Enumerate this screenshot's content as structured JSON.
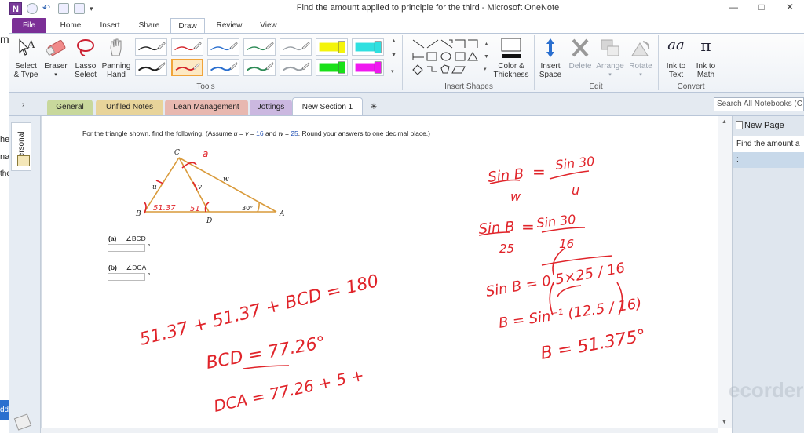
{
  "window": {
    "title": "Find the amount applied to principle for the third - Microsoft OneNote",
    "app_logo": "N",
    "controls": [
      "—",
      "□",
      "✕"
    ]
  },
  "ribbon_tabs": [
    "File",
    "Home",
    "Insert",
    "Share",
    "Draw",
    "Review",
    "View"
  ],
  "ribbon": {
    "tools_buttons": [
      {
        "label1": "Select",
        "label2": "& Type",
        "icon": "select-type-icon"
      },
      {
        "label1": "Eraser",
        "label2": "▾",
        "icon": "eraser-icon"
      },
      {
        "label1": "Lasso",
        "label2": "Select",
        "icon": "lasso-icon"
      },
      {
        "label1": "Panning",
        "label2": "Hand",
        "icon": "hand-icon"
      }
    ],
    "pen_colors": [
      "#222222",
      "#d4242a",
      "#2a6fcf",
      "#2e8b57",
      "#9aa0a6",
      "#f4f40a",
      "#2fe0e0",
      "#222222",
      "#d4242a",
      "#2a6fcf",
      "#2e8b57",
      "#9aa0a6",
      "#18e018",
      "#f018f0"
    ],
    "color_thickness": {
      "label1": "Color &",
      "label2": "Thickness"
    },
    "edit_buttons": [
      {
        "label1": "Insert",
        "label2": "Space",
        "dim": false
      },
      {
        "label1": "Delete",
        "label2": "",
        "dim": true
      },
      {
        "label1": "Arrange",
        "label2": "▾",
        "dim": true
      },
      {
        "label1": "Rotate",
        "label2": "▾",
        "dim": true
      }
    ],
    "convert_buttons": [
      {
        "label1": "Ink to",
        "label2": "Text",
        "glyph": "aa"
      },
      {
        "label1": "Ink to",
        "label2": "Math",
        "glyph": "π"
      }
    ],
    "group_labels": {
      "tools": "Tools",
      "shapes": "Insert Shapes",
      "edit": "Edit",
      "convert": "Convert"
    }
  },
  "section_tabs": [
    "General",
    "Unfiled Notes",
    "Lean Management",
    "Jottings",
    "New Section 1",
    "✳"
  ],
  "section_colors": [
    "#c8d89c",
    "#e8d49a",
    "#e8b8b0",
    "#cbb8e0",
    "#ffffff",
    "#e4eaf1"
  ],
  "search_placeholder": "Search All Notebooks (C",
  "notebook_label": "Personal",
  "left_edge_text": [
    "m",
    "he",
    "nal",
    "the",
    "dd"
  ],
  "page_list": {
    "new_page": "New Page",
    "items": [
      "Find the amount a",
      ":"
    ]
  },
  "problem": {
    "prefix": "For the triangle shown, find the following. (Assume ",
    "u": "u",
    "eq1": " = ",
    "v": "v",
    "eq2": " = ",
    "uv_value": "16",
    "and": " and ",
    "w": "w",
    "eq3": " = ",
    "w_value": "25",
    "suffix": ". Round your answers to one decimal place.)"
  },
  "triangle_labels": {
    "C": "C",
    "B": "B",
    "D": "D",
    "A": "A",
    "u": "u",
    "v": "v",
    "w": "w",
    "angle": "30°"
  },
  "parts": [
    {
      "letter": "(a)",
      "angle": "∠BCD",
      "unit": "°"
    },
    {
      "letter": "(b)",
      "angle": "∠DCA",
      "unit": "°"
    }
  ],
  "ink_notes": {
    "near_c": "a",
    "angle_b": "51.37",
    "angle_d": "51",
    "left_eq1": "51.37 + 51.37 + BCD = 180",
    "left_eq2": "BCD = 77.26°",
    "left_eq3": "DCA = 77.26 + 5 +",
    "right_eq1a": "Sin B",
    "right_eq1b": "w",
    "right_eq1c": "Sin 30",
    "right_eq1d": "u",
    "right_eq2a": "Sin B",
    "right_eq2b": "25",
    "right_eq2c": "Sin 30",
    "right_eq2d": "16",
    "right_eq3": "Sin B = 0.5×25 / 16",
    "right_eq4": "B = Sin⁻¹ (12.5 / 16)",
    "right_eq5": "B = 51.375°"
  },
  "watermark": "ecorder"
}
